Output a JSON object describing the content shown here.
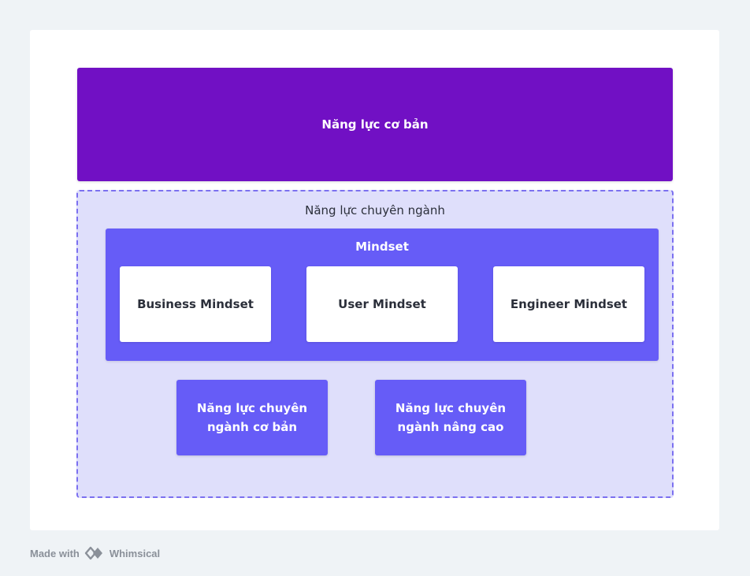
{
  "diagram": {
    "top_box": "Năng lực cơ bản",
    "group_title": "Năng lực chuyên ngành",
    "mindset": {
      "title": "Mindset",
      "items": [
        "Business Mindset",
        "User Mindset",
        "Engineer Mindset"
      ]
    },
    "bottom_boxes": [
      "Năng lực chuyên ngành cơ bản",
      "Năng lực chuyên ngành nâng cao"
    ]
  },
  "footer": {
    "made_with": "Made with",
    "brand": "Whimsical",
    "icon": "whimsical-logo-icon"
  },
  "colors": {
    "background": "#eff3f6",
    "top_box": "#7110c4",
    "group_fill": "#dfdffb",
    "group_border": "#7b70f0",
    "mindset": "#665cf7"
  }
}
